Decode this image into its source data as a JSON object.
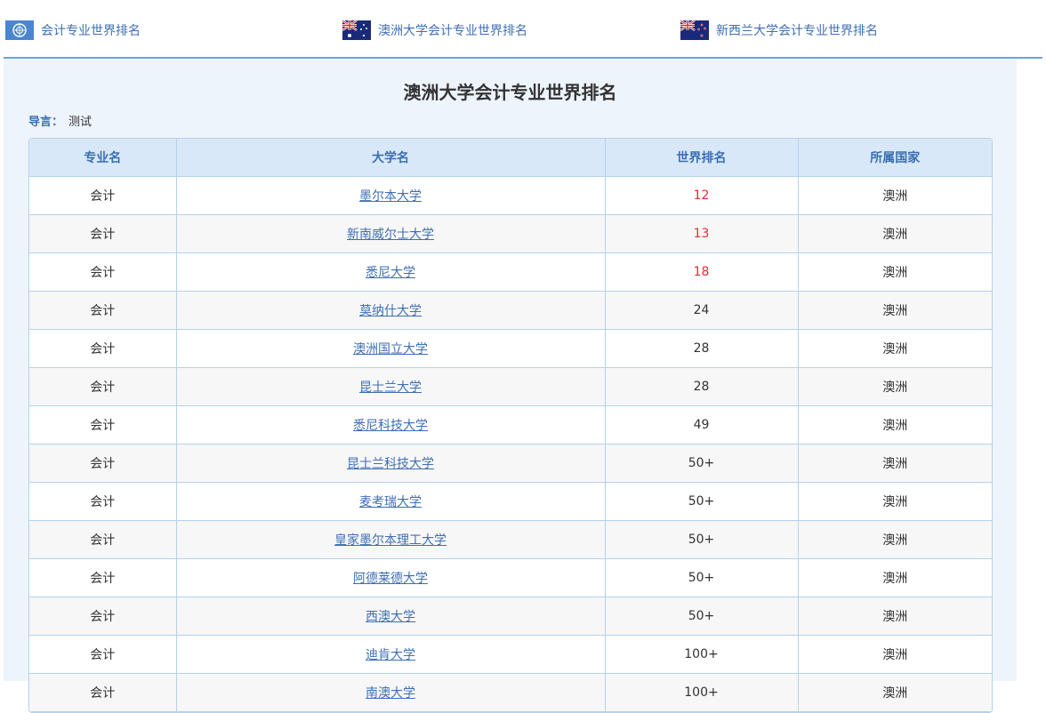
{
  "nav": {
    "tabs": [
      {
        "label": "会计专业世界排名",
        "icon": "un-flag-icon"
      },
      {
        "label": "澳洲大学会计专业世界排名",
        "icon": "australia-flag-icon"
      },
      {
        "label": "新西兰大学会计专业世界排名",
        "icon": "new-zealand-flag-icon"
      }
    ]
  },
  "page": {
    "title": "澳洲大学会计专业世界排名",
    "intro_label": "导言：",
    "intro_text": "测试"
  },
  "table": {
    "headers": [
      "专业名",
      "大学名",
      "世界排名",
      "所属国家"
    ],
    "rows": [
      {
        "major": "会计",
        "university": "墨尔本大学",
        "rank": "12",
        "country": "澳洲",
        "highlight": true
      },
      {
        "major": "会计",
        "university": "新南威尔士大学",
        "rank": "13",
        "country": "澳洲",
        "highlight": true
      },
      {
        "major": "会计",
        "university": "悉尼大学",
        "rank": "18",
        "country": "澳洲",
        "highlight": true
      },
      {
        "major": "会计",
        "university": "莫纳什大学",
        "rank": "24",
        "country": "澳洲",
        "highlight": false
      },
      {
        "major": "会计",
        "university": "澳洲国立大学",
        "rank": "28",
        "country": "澳洲",
        "highlight": false
      },
      {
        "major": "会计",
        "university": "昆士兰大学",
        "rank": "28",
        "country": "澳洲",
        "highlight": false
      },
      {
        "major": "会计",
        "university": "悉尼科技大学",
        "rank": "49",
        "country": "澳洲",
        "highlight": false
      },
      {
        "major": "会计",
        "university": "昆士兰科技大学",
        "rank": "50+",
        "country": "澳洲",
        "highlight": false
      },
      {
        "major": "会计",
        "university": "麦考瑞大学",
        "rank": "50+",
        "country": "澳洲",
        "highlight": false
      },
      {
        "major": "会计",
        "university": "皇家墨尔本理工大学",
        "rank": "50+",
        "country": "澳洲",
        "highlight": false
      },
      {
        "major": "会计",
        "university": "阿德莱德大学",
        "rank": "50+",
        "country": "澳洲",
        "highlight": false
      },
      {
        "major": "会计",
        "university": "西澳大学",
        "rank": "50+",
        "country": "澳洲",
        "highlight": false
      },
      {
        "major": "会计",
        "university": "迪肯大学",
        "rank": "100+",
        "country": "澳洲",
        "highlight": false
      },
      {
        "major": "会计",
        "university": "南澳大学",
        "rank": "100+",
        "country": "澳洲",
        "highlight": false
      }
    ]
  },
  "colors": {
    "accent": "#3f6fb5",
    "header_bg": "#d9e8f9",
    "panel_bg": "#eef4fc",
    "rank_highlight": "#e03030"
  }
}
